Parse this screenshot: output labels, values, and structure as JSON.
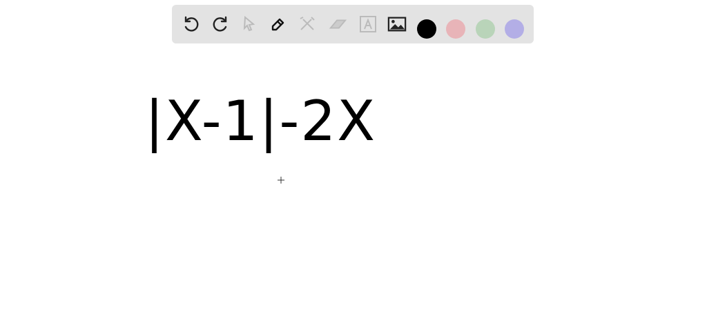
{
  "toolbar": {
    "tools": [
      "undo-icon",
      "redo-icon",
      "select-icon",
      "pen-icon",
      "tools-icon",
      "eraser-icon",
      "text-icon",
      "image-icon"
    ],
    "colors": [
      "#000000",
      "#e8b4b8",
      "#b9d4b9",
      "#b3aee6"
    ]
  },
  "canvas": {
    "handwriting_text": "|X-1|-2X"
  }
}
